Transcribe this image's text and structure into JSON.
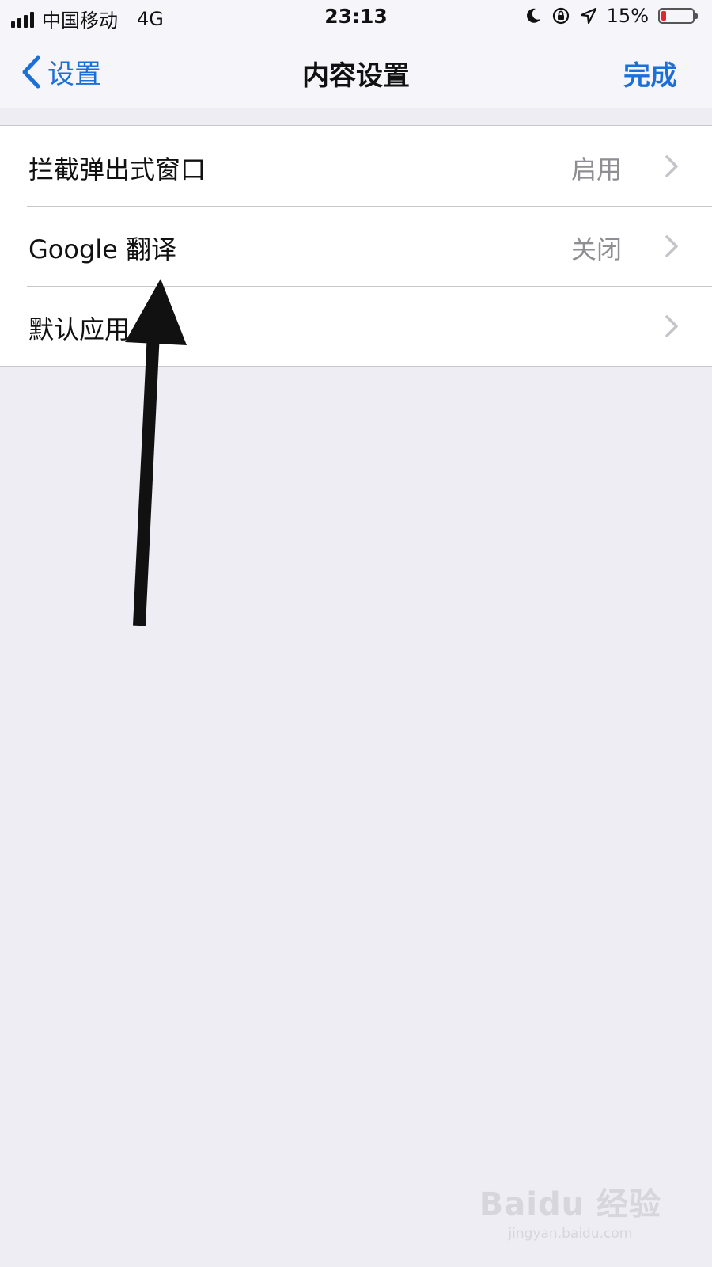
{
  "status_bar": {
    "carrier": "中国移动",
    "network": "4G",
    "time": "23:13",
    "battery_percent": "15%",
    "battery_level": 0.15,
    "icons": [
      "signal-icon",
      "moon-icon",
      "orientation-lock-icon",
      "location-icon",
      "battery-icon"
    ]
  },
  "nav": {
    "back_label": "设置",
    "title": "内容设置",
    "done_label": "完成"
  },
  "settings": {
    "rows": [
      {
        "label": "拦截弹出式窗口",
        "value": "启用"
      },
      {
        "label": "Google 翻译",
        "value": "关闭"
      },
      {
        "label": "默认应用",
        "value": ""
      }
    ]
  },
  "watermark": {
    "logo": "Baidu 经验",
    "url": "jingyan.baidu.com"
  },
  "colors": {
    "accent": "#1d6fd8",
    "background": "#efedf4",
    "battery_low": "#e0262e",
    "secondary_text": "#8e8e93"
  }
}
